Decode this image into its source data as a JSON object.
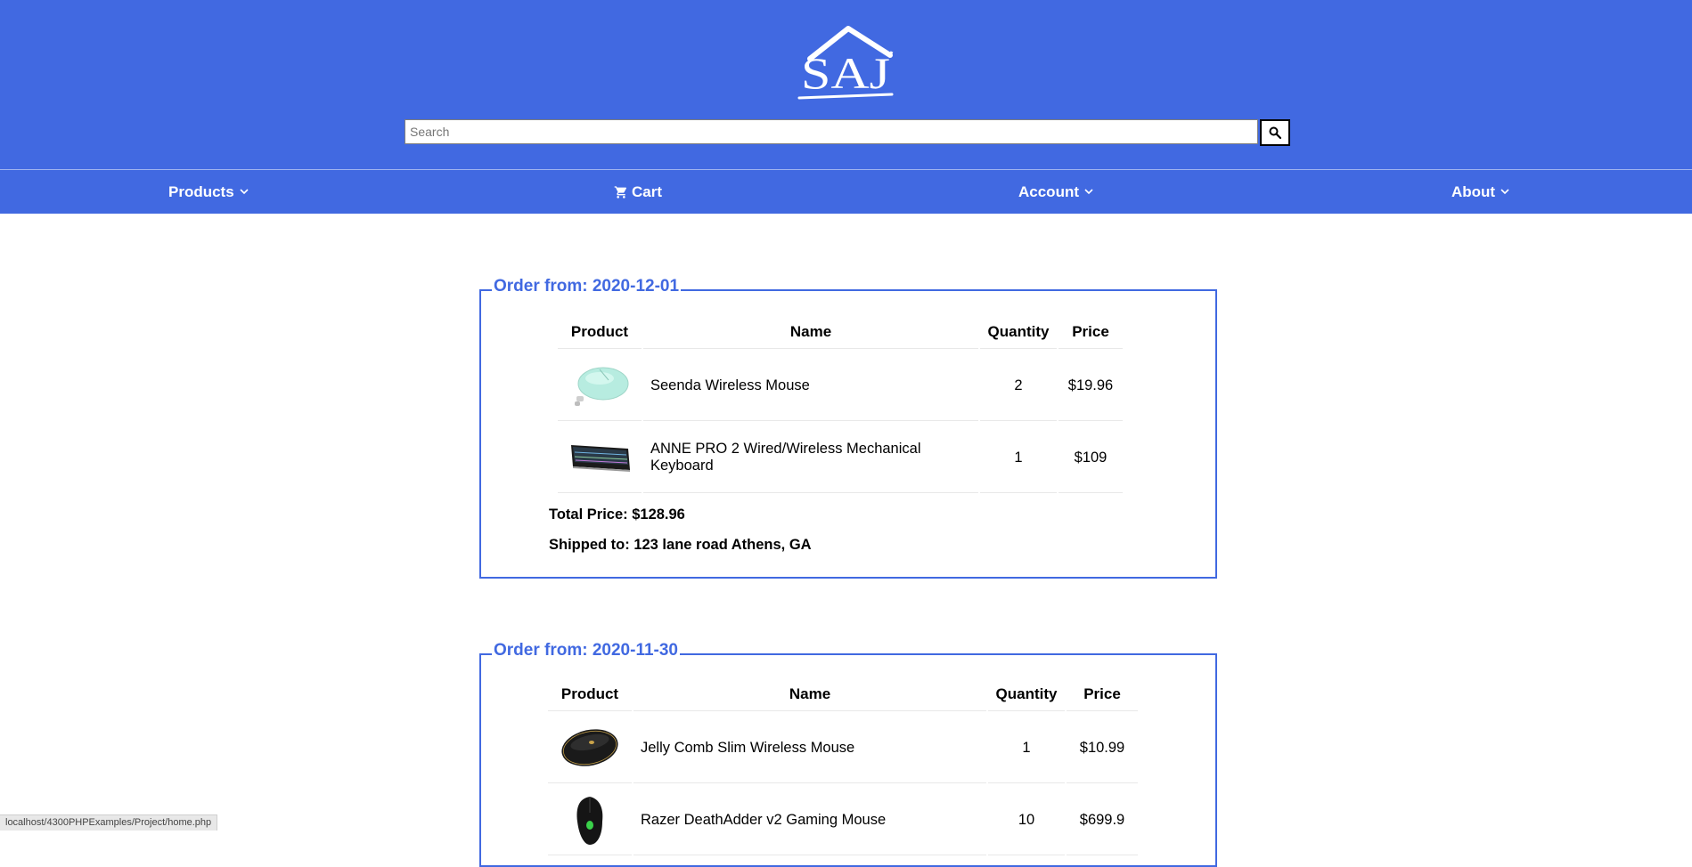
{
  "brand": {
    "logo_text": "SAJ"
  },
  "search": {
    "placeholder": "Search"
  },
  "nav": {
    "products": "Products",
    "cart": "Cart",
    "account": "Account",
    "about": "About"
  },
  "orders": [
    {
      "title": "Order from: 2020-12-01",
      "headers": {
        "product": "Product",
        "name": "Name",
        "quantity": "Quantity",
        "price": "Price"
      },
      "items": [
        {
          "name": "Seenda Wireless Mouse",
          "quantity": "2",
          "price": "$19.96",
          "image": "mint-mouse"
        },
        {
          "name": "ANNE PRO 2 Wired/Wireless Mechanical Keyboard",
          "quantity": "1",
          "price": "$109",
          "image": "keyboard"
        }
      ],
      "total": "Total Price: $128.96",
      "shipped": "Shipped to: 123 lane road Athens, GA"
    },
    {
      "title": "Order from: 2020-11-30",
      "headers": {
        "product": "Product",
        "name": "Name",
        "quantity": "Quantity",
        "price": "Price"
      },
      "items": [
        {
          "name": "Jelly Comb Slim Wireless Mouse",
          "quantity": "1",
          "price": "$10.99",
          "image": "black-mouse"
        },
        {
          "name": "Razer DeathAdder v2 Gaming Mouse",
          "quantity": "10",
          "price": "$699.9",
          "image": "gaming-mouse"
        }
      ]
    }
  ],
  "status_bar": {
    "url": "localhost/4300PHPExamples/Project/home.php"
  },
  "colors": {
    "brand_blue": "#4169e1",
    "white": "#ffffff"
  }
}
